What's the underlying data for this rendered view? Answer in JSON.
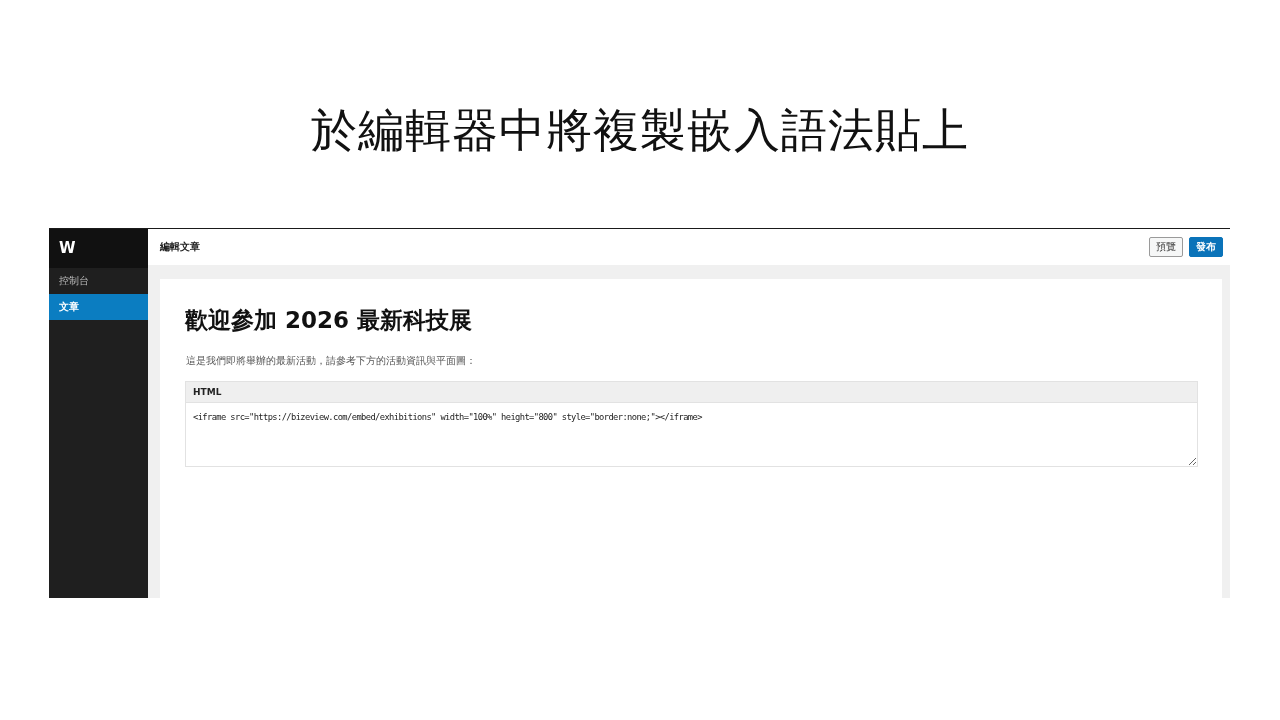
{
  "slide": {
    "title": "於編輯器中將複製嵌入語法貼上"
  },
  "editor": {
    "logo": "W",
    "sidebar": {
      "items": [
        {
          "label": "控制台",
          "selected": false
        },
        {
          "label": "文章",
          "selected": true
        }
      ]
    },
    "top_bar": {
      "title": "編輯文章",
      "buttons": [
        {
          "label": "預覽",
          "kind": "secondary"
        },
        {
          "label": "發布",
          "kind": "primary"
        }
      ]
    },
    "post": {
      "heading": "歡迎參加 2026 最新科技展",
      "paragraph": "這是我們即將舉辦的最新活動，請參考下方的活動資訊與平面圖：",
      "html_block": {
        "label": "HTML",
        "value": "<iframe src=\"https://bizeview.com/embed/exhibitions\" width=\"100%\" height=\"800\" style=\"border:none;\"></iframe>"
      }
    }
  }
}
